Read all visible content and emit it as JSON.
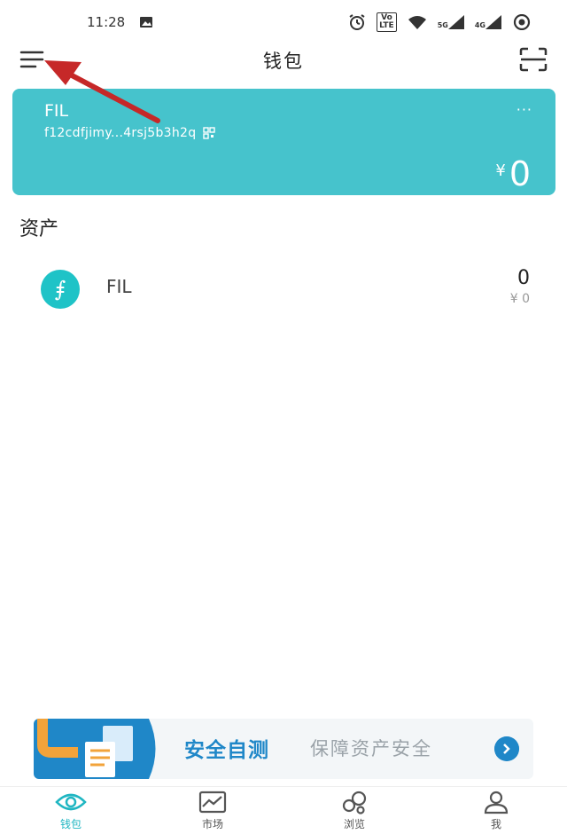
{
  "status_bar": {
    "time": "11:28",
    "volte_top": "Vo",
    "volte_bottom": "LTE",
    "net_5g": "5G",
    "net_4g": "4G"
  },
  "header": {
    "title": "钱包"
  },
  "wallet_card": {
    "name": "FIL",
    "address": "f12cdfjimy...4rsj5b3h2q",
    "more": "···",
    "currency": "¥",
    "balance": "0"
  },
  "assets": {
    "title": "资产",
    "items": [
      {
        "icon_glyph": "⨎",
        "name": "FIL",
        "amount": "0",
        "fiat": "¥ 0"
      }
    ]
  },
  "banner": {
    "title": "安全自测",
    "subtitle": "保障资产安全"
  },
  "bottom_nav": {
    "items": [
      {
        "label": "钱包"
      },
      {
        "label": "市场"
      },
      {
        "label": "浏览"
      },
      {
        "label": "我"
      }
    ]
  },
  "colors": {
    "card": "#46c3cc",
    "accent": "#1fb6c2",
    "banner_blue": "#1f87c8",
    "annotation_red": "#c62828"
  }
}
